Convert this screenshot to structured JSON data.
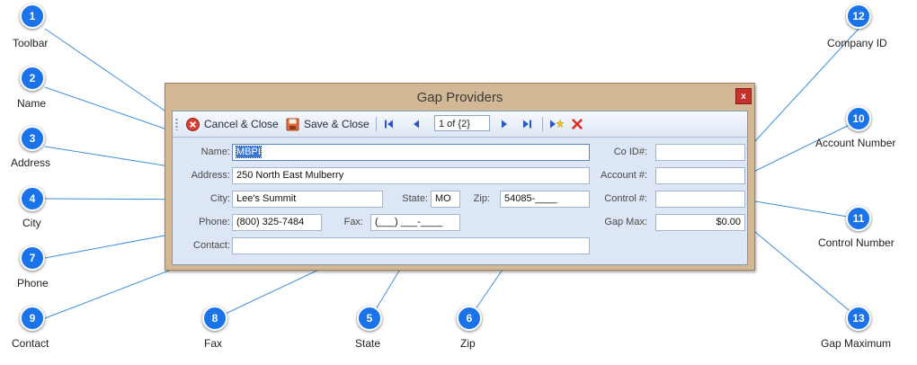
{
  "window": {
    "title": "Gap Providers",
    "close_label": "x"
  },
  "toolbar": {
    "cancel_close_label": "Cancel & Close",
    "save_close_label": "Save & Close",
    "pager_value": "1 of {2}"
  },
  "form": {
    "name_label": "Name:",
    "name_value": "MBPI",
    "address_label": "Address:",
    "address_value": "250 North East Mulberry",
    "city_label": "City:",
    "city_value": "Lee's Summit",
    "state_label": "State:",
    "state_value": "MO",
    "zip_label": "Zip:",
    "zip_value": "54085-____",
    "phone_label": "Phone:",
    "phone_value": "(800) 325-7484",
    "fax_label": "Fax:",
    "fax_value": "(___) ___-____",
    "contact_label": "Contact:",
    "contact_value": "",
    "coid_label": "Co ID#:",
    "coid_value": "",
    "account_label": "Account #:",
    "account_value": "",
    "control_label": "Control #:",
    "control_value": "",
    "gapmax_label": "Gap Max:",
    "gapmax_value": "$0.00"
  },
  "callouts": [
    {
      "number": "1",
      "label": "Toolbar"
    },
    {
      "number": "2",
      "label": "Name"
    },
    {
      "number": "3",
      "label": "Address"
    },
    {
      "number": "4",
      "label": "City"
    },
    {
      "number": "7",
      "label": "Phone"
    },
    {
      "number": "9",
      "label": "Contact"
    },
    {
      "number": "8",
      "label": "Fax"
    },
    {
      "number": "5",
      "label": "State"
    },
    {
      "number": "6",
      "label": "Zip"
    },
    {
      "number": "12",
      "label": "Company ID"
    },
    {
      "number": "10",
      "label": "Account Number"
    },
    {
      "number": "11",
      "label": "Control Number"
    },
    {
      "number": "13",
      "label": "Gap Maximum"
    }
  ],
  "colors": {
    "badge": "#1a73e8",
    "window_frame": "#d3b896",
    "panel": "#dce6f4",
    "callout_line": "#3d8fd9"
  }
}
